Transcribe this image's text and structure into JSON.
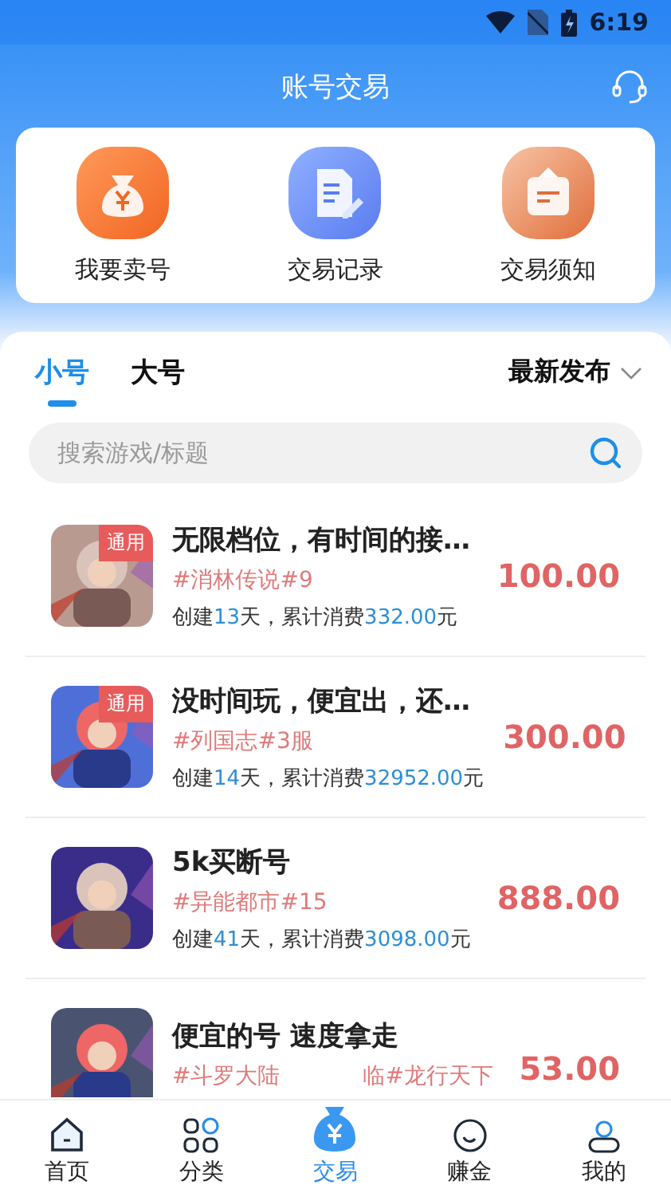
{
  "status_bar": {
    "time": "6:19"
  },
  "header": {
    "title": "账号交易"
  },
  "quick_actions": [
    {
      "kind": "sell",
      "label": "我要卖号"
    },
    {
      "kind": "records",
      "label": "交易记录"
    },
    {
      "kind": "notice",
      "label": "交易须知"
    }
  ],
  "tabs": [
    {
      "label": "小号",
      "selected": true
    },
    {
      "label": "大号",
      "selected": false
    }
  ],
  "sort": {
    "label": "最新发布"
  },
  "search": {
    "placeholder": "搜索游戏/标题"
  },
  "listings": [
    {
      "title": "无限档位，有时间的接…",
      "badge": "通用",
      "tag_parts": [
        "#消林传说#9"
      ],
      "price": "100.00",
      "meta": [
        {
          "text": "创建",
          "highlight": false
        },
        {
          "text": "13",
          "highlight": true
        },
        {
          "text": "天，累计消费",
          "highlight": false
        },
        {
          "text": "332.00",
          "highlight": true
        },
        {
          "text": "元",
          "highlight": false
        }
      ]
    },
    {
      "title": "没时间玩，便宜出，还…",
      "badge": "通用",
      "tag_parts": [
        "#列国志#3服"
      ],
      "price": "300.00",
      "meta": [
        {
          "text": "创建",
          "highlight": false
        },
        {
          "text": "14",
          "highlight": true
        },
        {
          "text": "天，累计消费",
          "highlight": false
        },
        {
          "text": "32952.00",
          "highlight": true
        },
        {
          "text": "元",
          "highlight": false
        }
      ]
    },
    {
      "title": "5k买断号",
      "tag_parts": [
        "#异能都市#15"
      ],
      "price": "888.00",
      "meta": [
        {
          "text": "创建",
          "highlight": false
        },
        {
          "text": "41",
          "highlight": true
        },
        {
          "text": "天，累计消费",
          "highlight": false
        },
        {
          "text": "3098.00",
          "highlight": true
        },
        {
          "text": "元",
          "highlight": false
        }
      ]
    },
    {
      "title": "便宜的号 速度拿走",
      "tag_parts": [
        "#斗罗大陆",
        "临#龙行天下"
      ],
      "price": "53.00"
    }
  ],
  "bottom_nav": [
    {
      "kind": "home",
      "label": "首页",
      "selected": false
    },
    {
      "kind": "category",
      "label": "分类",
      "selected": false
    },
    {
      "kind": "trade",
      "label": "交易",
      "selected": true
    },
    {
      "kind": "earn",
      "label": "赚金",
      "selected": false
    },
    {
      "kind": "me",
      "label": "我的",
      "selected": false
    }
  ]
}
